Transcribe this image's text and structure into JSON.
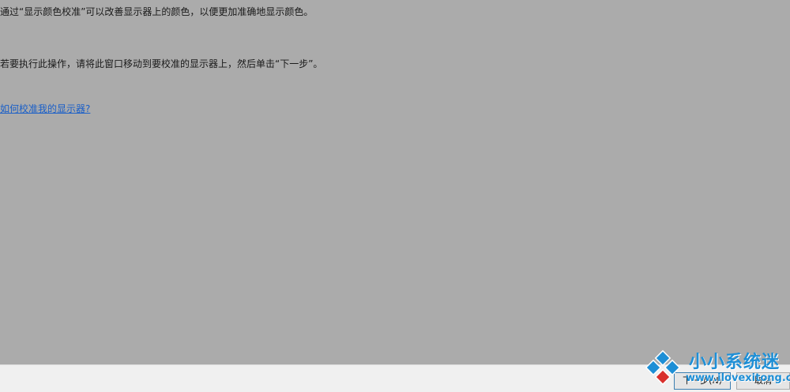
{
  "wizard": {
    "intro_text": "通过“显示颜色校准”可以改善显示器上的颜色，以便更加准确地显示颜色。",
    "instruction_text": "若要执行此操作，请将此窗口移动到要校准的显示器上，然后单击“下一步”。",
    "help_link": "如何校准我的显示器?"
  },
  "footer": {
    "next_label": "下一步(N)",
    "cancel_label": "取消"
  },
  "watermark": {
    "name": "小小系统迷",
    "url": "www.ilovexitong.com"
  },
  "colors": {
    "background": "#ababab",
    "link": "#1a5fc8",
    "footer": "#f0f0f0",
    "watermark_blue": "#1e8fd6",
    "watermark_red": "#d9302c"
  }
}
